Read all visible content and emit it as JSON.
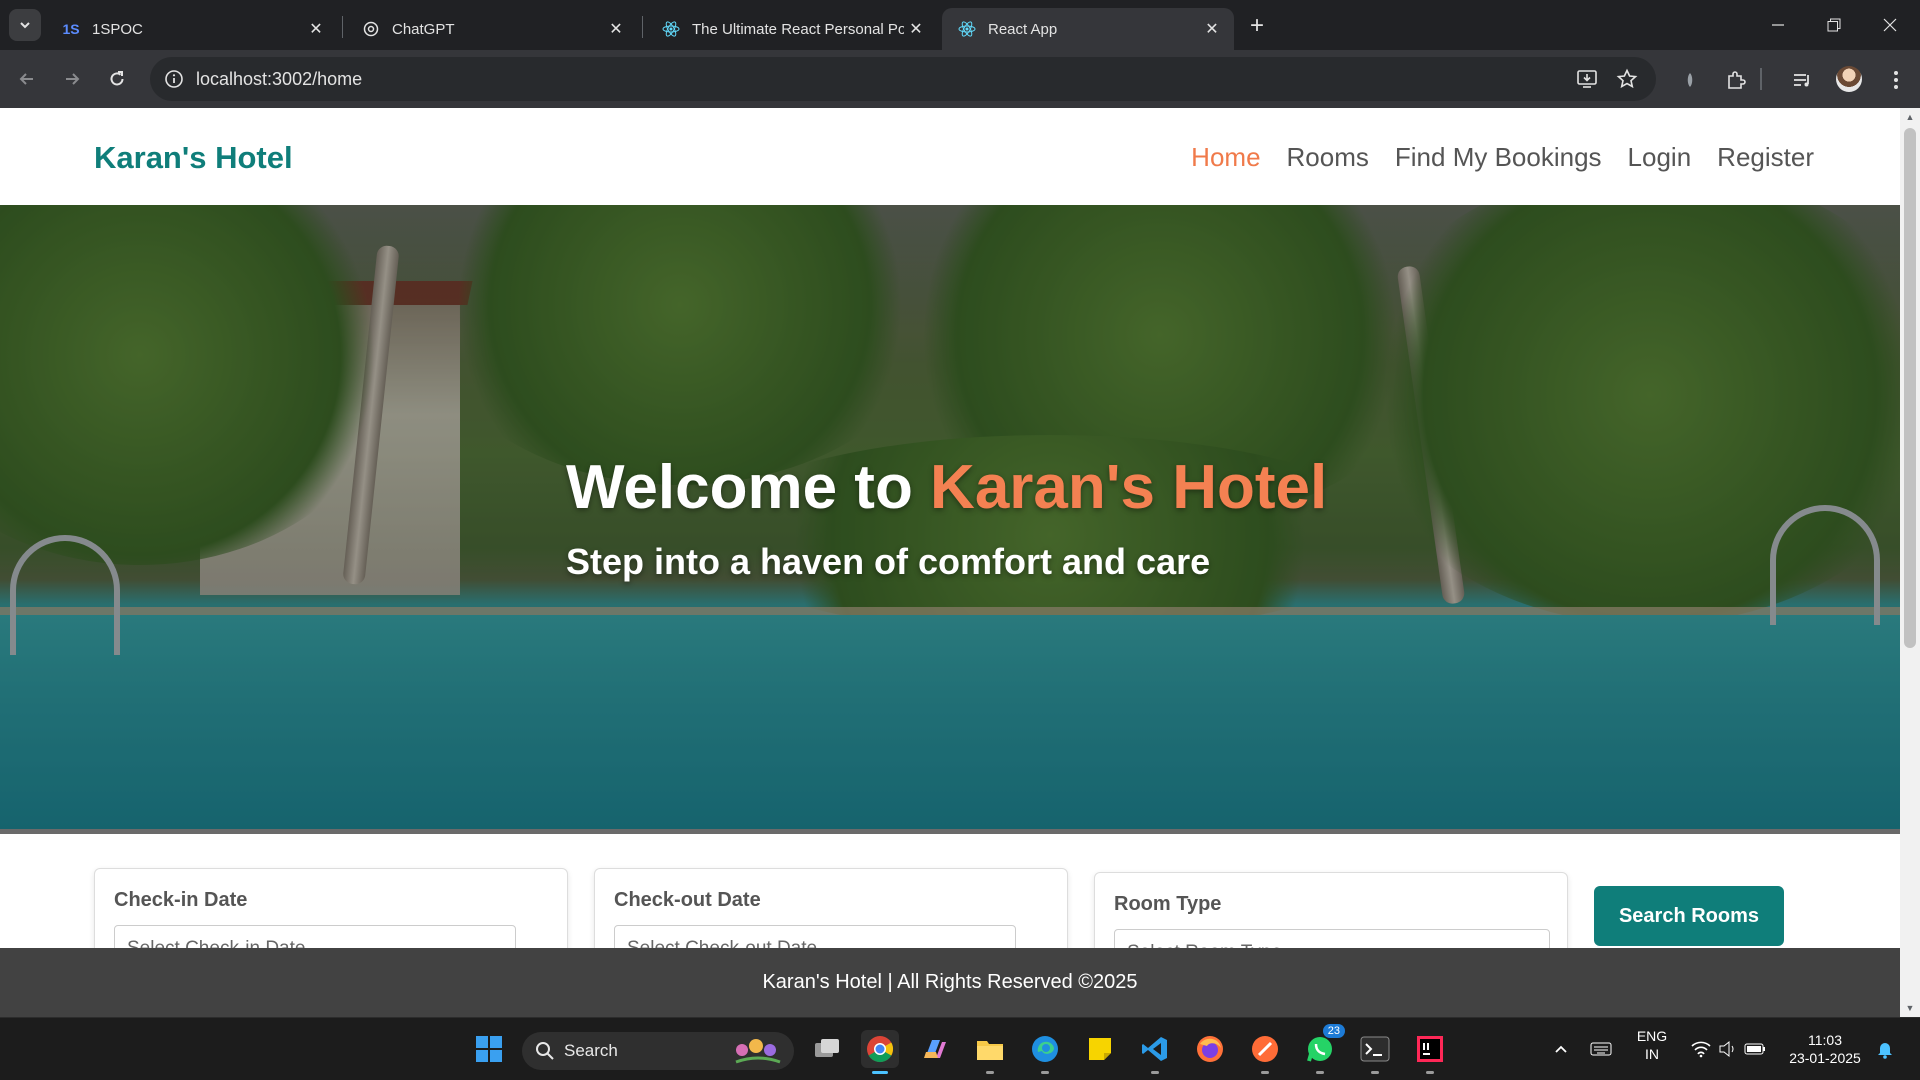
{
  "browser": {
    "tabs": [
      {
        "title": "1SPOC",
        "favicon_text": "1S",
        "active": false
      },
      {
        "title": "ChatGPT",
        "active": false
      },
      {
        "title": "The Ultimate React Personal Por",
        "active": false
      },
      {
        "title": "React App",
        "active": true
      }
    ],
    "url": "localhost:3002/home"
  },
  "site": {
    "brand": "Karan's Hotel",
    "nav": [
      {
        "label": "Home",
        "active": true
      },
      {
        "label": "Rooms",
        "active": false
      },
      {
        "label": "Find My Bookings",
        "active": false
      },
      {
        "label": "Login",
        "active": false
      },
      {
        "label": "Register",
        "active": false
      }
    ],
    "hero": {
      "title_prefix": "Welcome to ",
      "title_accent": "Karan's Hotel",
      "subtitle": "Step into a haven of comfort and care"
    },
    "search": {
      "checkin_label": "Check-in Date",
      "checkin_placeholder": "Select Check-in Date",
      "checkout_label": "Check-out Date",
      "checkout_placeholder": "Select Check-out Date",
      "roomtype_label": "Room Type",
      "roomtype_placeholder": "Select Room Type",
      "button": "Search Rooms"
    },
    "footer": "Karan's Hotel | All Rights Reserved ©2025",
    "colors": {
      "brand": "#0f7e7a",
      "accent": "#f07a4a",
      "footer_bg": "#424242"
    }
  },
  "taskbar": {
    "search_label": "Search",
    "whatsapp_badge": "23",
    "lang_line1": "ENG",
    "lang_line2": "IN",
    "time": "11:03",
    "date": "23-01-2025"
  }
}
